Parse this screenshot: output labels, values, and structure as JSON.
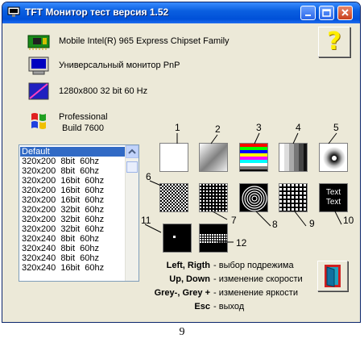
{
  "window": {
    "title": "TFT Монитор тест версия 1.52"
  },
  "info": {
    "chipset": "Mobile Intel(R) 965 Express Chipset Family",
    "monitor": "Универсальный монитор PnP",
    "resolution": "1280x800 32 bit 60 Hz",
    "os_line1": "Professional",
    "os_line2": "Build 7600"
  },
  "help_button": "?",
  "modes": [
    "Default",
    "320x200  8bit  60hz",
    "320x200  8bit  60hz",
    "320x200  16bit  60hz",
    "320x200  16bit  60hz",
    "320x200  16bit  60hz",
    "320x200  32bit  60hz",
    "320x200  32bit  60hz",
    "320x200  32bit  60hz",
    "320x240  8bit  60hz",
    "320x240  8bit  60hz",
    "320x240  8bit  60hz",
    "320x240  16bit  60hz"
  ],
  "tests": [
    "1",
    "2",
    "3",
    "4",
    "5",
    "6",
    "7",
    "8",
    "9",
    "10",
    "11",
    "12"
  ],
  "test10_text": [
    "Text",
    "Text"
  ],
  "keys": [
    {
      "key": "Left, Rigth",
      "desc": "- выбор подрежима"
    },
    {
      "key": "Up, Down",
      "desc": "- изменение скорости"
    },
    {
      "key": "Grey-, Grey +",
      "desc": "- изменение яркости"
    },
    {
      "key": "Esc",
      "desc": "- выход"
    }
  ],
  "caption": "9",
  "colors": {
    "titlebar": "#0050d8",
    "selection": "#316ac5",
    "help_question": "#ffee00"
  }
}
